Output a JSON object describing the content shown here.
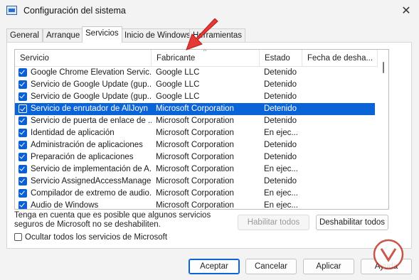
{
  "window": {
    "title": "Configuración del sistema",
    "close_glyph": "✕"
  },
  "tabs": [
    {
      "label": "General"
    },
    {
      "label": "Arranque"
    },
    {
      "label": "Servicios",
      "active": true
    },
    {
      "label": "Inicio de Windows"
    },
    {
      "label": "Herramientas"
    }
  ],
  "table": {
    "columns": [
      "Servicio",
      "Fabricante",
      "Estado",
      "Fecha de desha..."
    ],
    "rows": [
      {
        "service": "Google Chrome Elevation Servic...",
        "maker": "Google LLC",
        "state": "Detenido",
        "checked": true
      },
      {
        "service": "Servicio de Google Update (gup...",
        "maker": "Google LLC",
        "state": "Detenido",
        "checked": true
      },
      {
        "service": "Servicio de Google Update (gup...",
        "maker": "Google LLC",
        "state": "Detenido",
        "checked": true
      },
      {
        "service": "Servicio de enrutador de AllJoyn",
        "maker": "Microsoft Corporation",
        "state": "Detenido",
        "checked": true,
        "selected": true
      },
      {
        "service": "Servicio de puerta de enlace de ...",
        "maker": "Microsoft Corporation",
        "state": "Detenido",
        "checked": true
      },
      {
        "service": "Identidad de aplicación",
        "maker": "Microsoft Corporation",
        "state": "En ejec...",
        "checked": true
      },
      {
        "service": "Administración de aplicaciones",
        "maker": "Microsoft Corporation",
        "state": "Detenido",
        "checked": true
      },
      {
        "service": "Preparación de aplicaciones",
        "maker": "Microsoft Corporation",
        "state": "Detenido",
        "checked": true
      },
      {
        "service": "Servicio de implementación de A...",
        "maker": "Microsoft Corporation",
        "state": "En ejec...",
        "checked": true
      },
      {
        "service": "Servicio AssignedAccessManager",
        "maker": "Microsoft Corporation",
        "state": "Detenido",
        "checked": true
      },
      {
        "service": "Compilador de extremo de audio...",
        "maker": "Microsoft Corporation",
        "state": "En ejec...",
        "checked": true
      },
      {
        "service": "Audio de Windows",
        "maker": "Microsoft Corporation",
        "state": "En ejec...",
        "checked": true
      }
    ]
  },
  "note": "Tenga en cuenta que es posible que algunos servicios seguros de Microsoft no se deshabiliten.",
  "buttons": {
    "enable_all": "Habilitar todos",
    "disable_all": "Deshabilitar todos",
    "ok": "Aceptar",
    "cancel": "Cancelar",
    "apply": "Aplicar",
    "help": "Ayuda"
  },
  "hide_ms_label": "Ocultar todos los servicios de Microsoft",
  "colors": {
    "accent": "#0a64d8",
    "annotation_arrow": "#e53935"
  }
}
